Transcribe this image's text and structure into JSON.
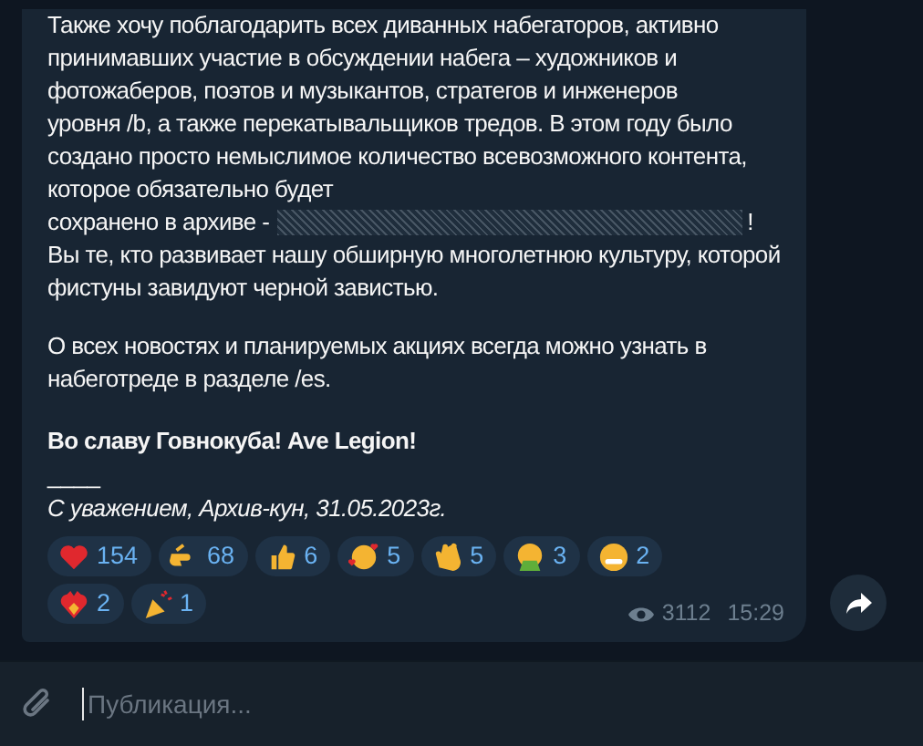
{
  "message": {
    "paragraphs": [
      {
        "kind": "spoilered",
        "text": "Также хочу поблагодарить всех диванных набегаторов, активно принимавших участие в обсуждении набега – художников и фотожаберов, поэтов и музыкантов, стратегов и инженеров уровня /b, а также перекатывальщиков тредов. В этом году было создано просто немыслимое количество всевозможного контента, которое обязательно будет",
        "before": "сохранено в архиве -",
        "after": "!",
        "text_after": "Вы те, кто развивает нашу обширную многолетнюю культуру, которой фистуны завидуют черной завистью."
      },
      {
        "kind": "plain",
        "text": "О всех новостях и планируемых акциях всегда можно узнать в набеготреде в разделе /es."
      },
      {
        "kind": "bold",
        "text": "Во славу Говнокуба! Ave Legion!"
      },
      {
        "kind": "signature",
        "rule": "____",
        "text": "С уважением, Архив-кун, 31.05.2023г."
      }
    ],
    "reactions": [
      {
        "kind": "heart",
        "count": "154"
      },
      {
        "kind": "point",
        "count": "68"
      },
      {
        "kind": "thumbs",
        "count": "6"
      },
      {
        "kind": "hearts-face",
        "count": "5"
      },
      {
        "kind": "clap",
        "count": "5"
      },
      {
        "kind": "sick",
        "count": "3"
      },
      {
        "kind": "grin",
        "count": "2"
      },
      {
        "kind": "fire-heart",
        "count": "2"
      },
      {
        "kind": "party",
        "count": "1"
      }
    ],
    "views": "3112",
    "time": "15:29"
  },
  "composer": {
    "placeholder": "Публикация..."
  }
}
